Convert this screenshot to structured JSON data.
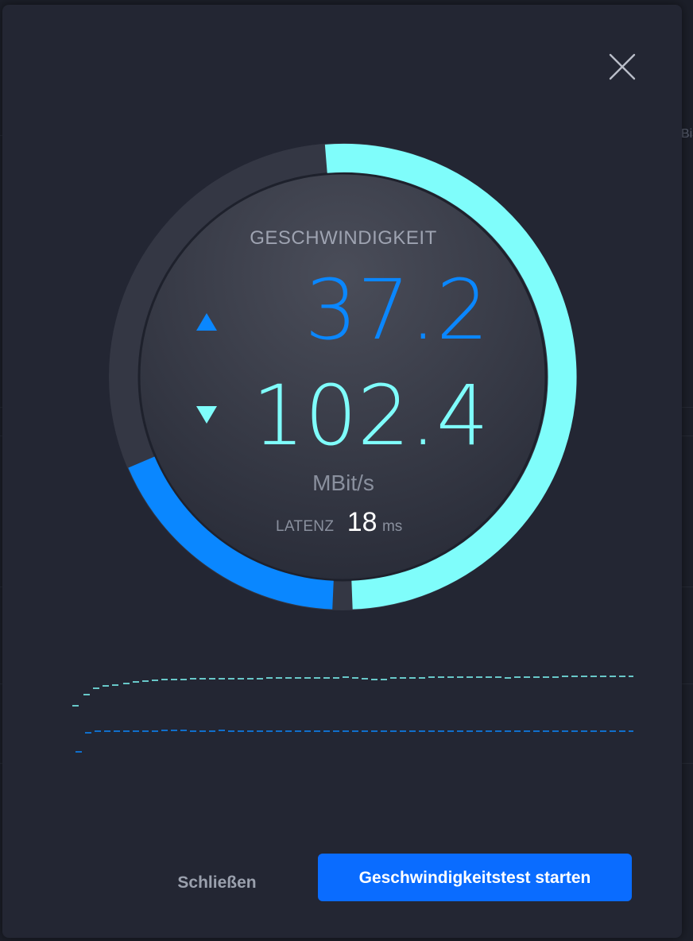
{
  "colors": {
    "upload": "#0a87ff",
    "download": "#7ffdfb",
    "primary_button": "#0a6cff",
    "modal_bg": "#232633"
  },
  "dialog": {
    "close_icon": "close-icon"
  },
  "gauge": {
    "title": "GESCHWINDIGKEIT",
    "upload_icon": "triangle-up-icon",
    "download_icon": "triangle-down-icon",
    "upload_value": "37.2",
    "download_value": "102.4",
    "unit": "MBit/s",
    "latency_label": "LATENZ",
    "latency_value": "18",
    "latency_unit": "ms",
    "upload_fraction": 0.186,
    "download_fraction": 0.512
  },
  "buttons": {
    "close_label": "Schließen",
    "start_label": "Geschwindigkeitstest starten"
  },
  "backdrop": {
    "edge_text": "Bi"
  }
}
